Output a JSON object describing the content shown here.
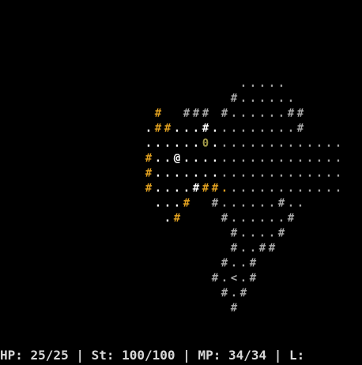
{
  "colors": {
    "background": "#000000",
    "lit_floor": "#ffffff",
    "remembered": "#a8a8a8",
    "torch_wall": "#e0a020",
    "item": "#a09848",
    "player": "#ffffff",
    "status_text": "#d8d8d8"
  },
  "legend": {
    "@": "player",
    "#": "wall",
    ".": "floor",
    "<": "up-staircase",
    "0": "item"
  },
  "map_rows": [
    "                                                ",
    "                         .....                  ",
    "                        #......                 ",
    "                #  ### #......##                ",
    "               .##...#.........#                ",
    "               ......0..............            ",
    "               #..@.................            ",
    "               #....................            ",
    "               #....###.............            ",
    "                ...#  #......#..                ",
    "                 .#    #......#                 ",
    "                        #....#                  ",
    "                        #..##                   ",
    "                       #..#                     ",
    "                      #.<.#                      ",
    "                       #.#                      ",
    "                        #                       "
  ],
  "status": {
    "text": "HP: 25/25 | St: 100/100 | MP: 34/34 | L:"
  }
}
